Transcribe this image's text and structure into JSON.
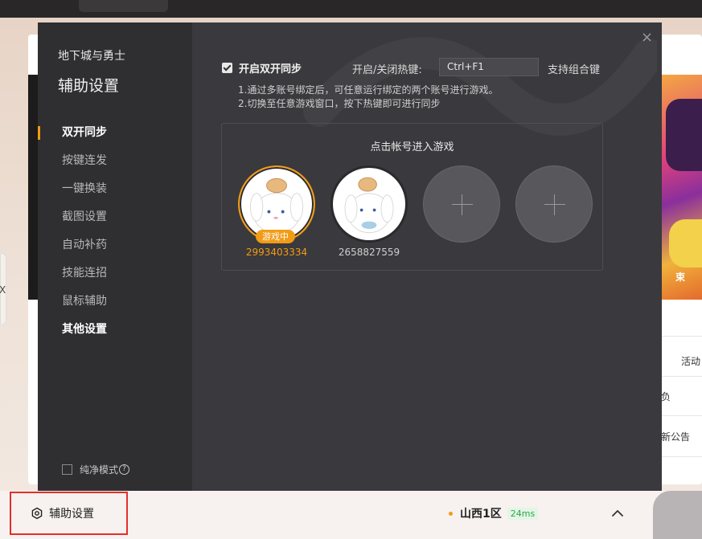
{
  "dialog": {
    "game_title": "地下城与勇士",
    "title": "辅助设置",
    "close_icon": "×",
    "nav": [
      {
        "label": "双开同步",
        "active": true
      },
      {
        "label": "按键连发"
      },
      {
        "label": "一键换装"
      },
      {
        "label": "截图设置"
      },
      {
        "label": "自动补药"
      },
      {
        "label": "技能连招"
      },
      {
        "label": "鼠标辅助"
      },
      {
        "label": "其他设置",
        "bold": true
      }
    ],
    "pure_mode": {
      "label": "纯净模式",
      "help": "?",
      "checked": false
    },
    "sync": {
      "enable_label": "开启双开同步",
      "checked": true,
      "hotkey_label": "开启/关闭热键:",
      "hotkey_value": "Ctrl+F1",
      "combo_label": "支持组合键",
      "desc1": "1.通过多账号绑定后，可任意运行绑定的两个账号进行游戏。",
      "desc2": "2.切换至任意游戏窗口，按下热键即可进行同步"
    },
    "accounts": {
      "title": "点击帐号进入游戏",
      "items": [
        {
          "id": "2993403334",
          "badge": "游戏中",
          "status": "playing"
        },
        {
          "id": "2658827559",
          "status": "idle"
        },
        {
          "status": "empty",
          "icon": "plus-icon"
        },
        {
          "status": "empty",
          "icon": "plus-icon"
        }
      ]
    }
  },
  "bottom": {
    "assist_label": "辅助设置",
    "server": "山西1区",
    "ping": "24ms"
  },
  "background": {
    "side_items": [
      "活动",
      "负",
      "新公告"
    ],
    "banner_text": "束",
    "left_tab_text": "X"
  },
  "colors": {
    "accent": "#f29b16",
    "dialog_bg": "#3a393d",
    "sidebar_bg": "#2f2e31",
    "highlight_border": "#e52d2d",
    "ping_green": "#2aa845"
  }
}
